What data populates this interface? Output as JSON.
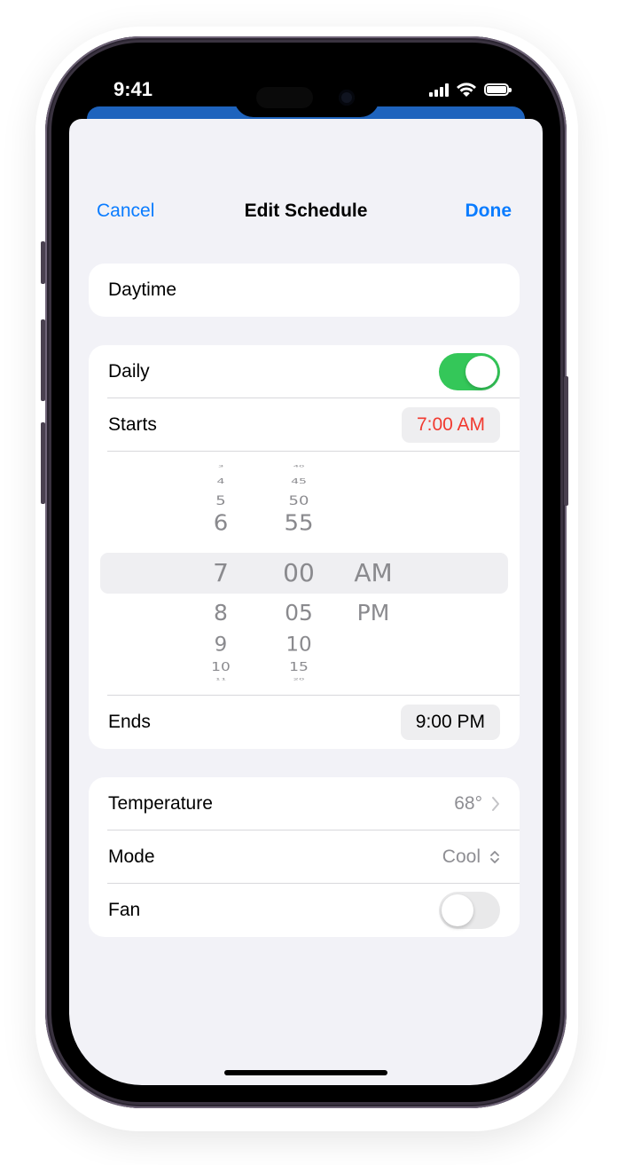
{
  "status_bar": {
    "time": "9:41"
  },
  "nav": {
    "cancel": "Cancel",
    "title": "Edit Schedule",
    "done": "Done"
  },
  "name_field": {
    "value": "Daytime"
  },
  "schedule": {
    "daily_label": "Daily",
    "daily_on": true,
    "starts_label": "Starts",
    "starts_value": "7:00 AM",
    "ends_label": "Ends",
    "ends_value": "9:00 PM",
    "picker": {
      "hours": [
        "3",
        "4",
        "5",
        "6",
        "7",
        "8",
        "9",
        "10",
        "11"
      ],
      "minutes": [
        "40",
        "45",
        "50",
        "55",
        "00",
        "05",
        "10",
        "15",
        "20"
      ],
      "periods": [
        "AM",
        "PM"
      ],
      "selected_hour": "7",
      "selected_minute": "00",
      "selected_period": "AM"
    }
  },
  "settings": {
    "temperature_label": "Temperature",
    "temperature_value": "68°",
    "mode_label": "Mode",
    "mode_value": "Cool",
    "fan_label": "Fan",
    "fan_on": false
  },
  "colors": {
    "accent": "#0a7cff",
    "toggle_on": "#34c759",
    "time_active": "#f13a30",
    "background": "#f2f2f7"
  },
  "icons": {
    "chevron": "chevron-right-icon",
    "mode": "chevron-up-down-icon"
  }
}
